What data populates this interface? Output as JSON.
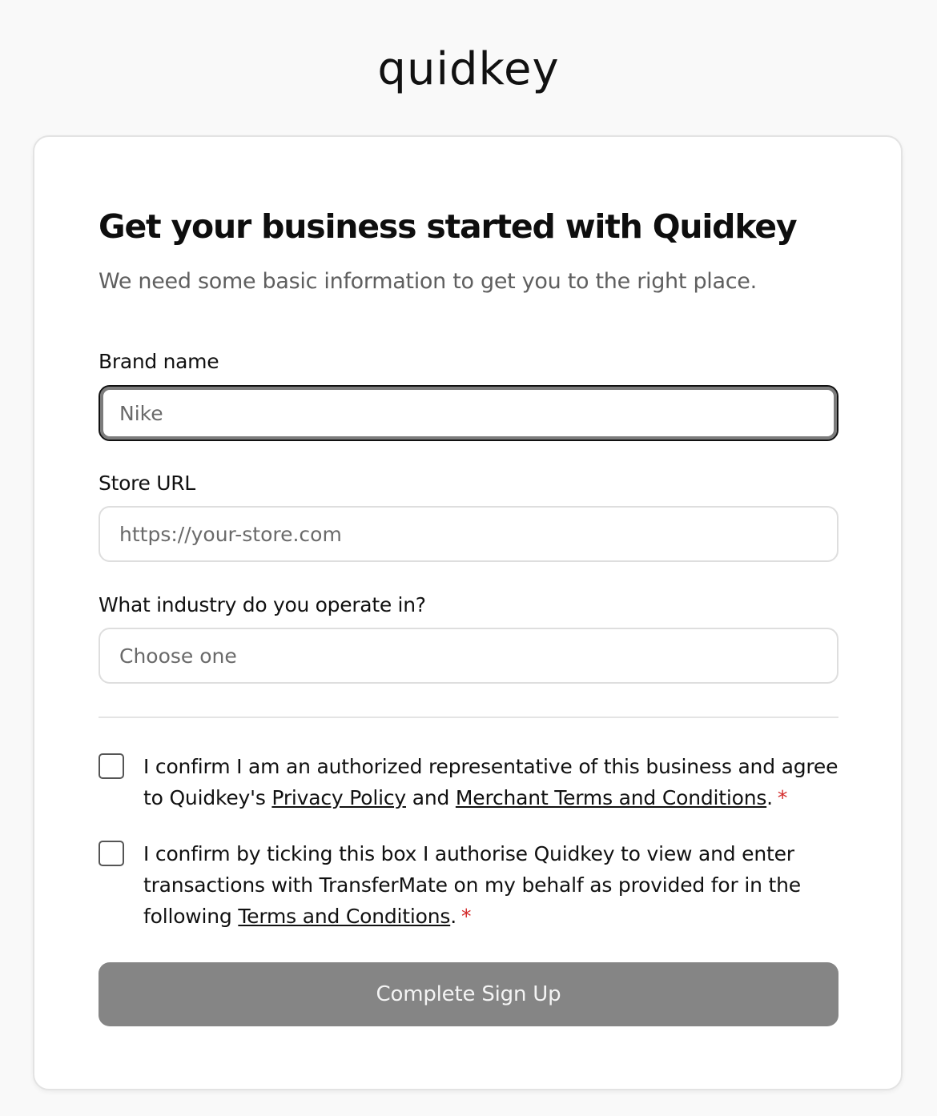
{
  "brand": {
    "logo_text": "quidkey"
  },
  "form": {
    "title": "Get your business started with Quidkey",
    "subtitle": "We need some basic information to get you to the right place.",
    "brand_name": {
      "label": "Brand name",
      "placeholder": "Nike",
      "value": ""
    },
    "store_url": {
      "label": "Store URL",
      "placeholder": "https://your-store.com",
      "value": ""
    },
    "industry": {
      "label": "What industry do you operate in?",
      "selected": "Choose one"
    },
    "consent1": {
      "checked": false,
      "text_before": "I confirm I am an authorized representative of this business and agree to Quidkey's ",
      "link1": "Privacy Policy",
      "text_middle": " and ",
      "link2": "Merchant Terms and Conditions",
      "text_after": ".",
      "required_mark": "*"
    },
    "consent2": {
      "checked": false,
      "text_before": "I confirm by ticking this box I authorise Quidkey to view and enter transactions with TransferMate on my behalf as provided for in the following ",
      "link1": "Terms and Conditions",
      "text_after": ".",
      "required_mark": "*"
    },
    "submit_label": "Complete Sign Up"
  },
  "colors": {
    "background": "#f9f9f9",
    "card": "#ffffff",
    "button_disabled": "#858585",
    "required": "#d32a2a"
  }
}
